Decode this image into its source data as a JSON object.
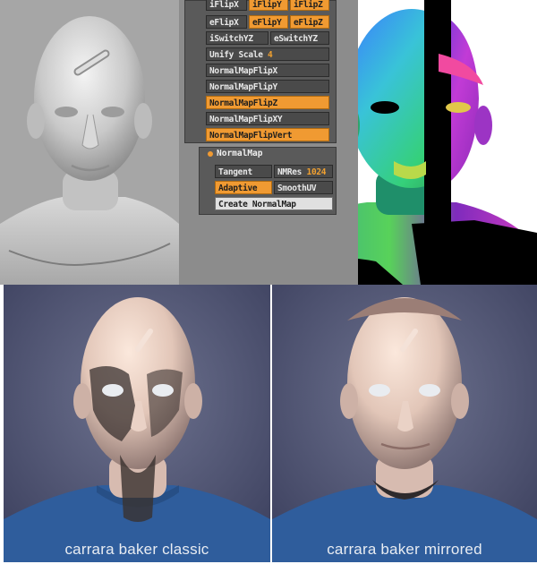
{
  "zbrush_panel": {
    "row0": [
      "iFlipX",
      "iFlipY",
      "iFlipZ"
    ],
    "row1": [
      "eFlipX",
      "eFlipY",
      "eFlipZ"
    ],
    "row2": [
      "iSwitchYZ",
      "eSwitchYZ"
    ],
    "unify_scale_label": "Unify Scale",
    "unify_scale_value": "4",
    "normalmap_flips": [
      "NormalMapFlipX",
      "NormalMapFlipY",
      "NormalMapFlipZ",
      "NormalMapFlipXY",
      "NormalMapFlipVert"
    ],
    "normalmap_section": {
      "title": "NormalMap",
      "tangent": "Tangent",
      "nmres_label": "NMRes",
      "nmres_value": "1024",
      "adaptive": "Adaptive",
      "smoothuv": "SmoothUV",
      "create": "Create NormalMap"
    }
  },
  "captions": {
    "left": "carrara baker classic",
    "right": "carrara baker mirrored"
  },
  "colors": {
    "button_active": "#f09a32",
    "button_default": "#4a4a4a",
    "render_background": "#4b4f6e",
    "shirt": "#2f5d9c",
    "skin": "#e6cdbf"
  }
}
